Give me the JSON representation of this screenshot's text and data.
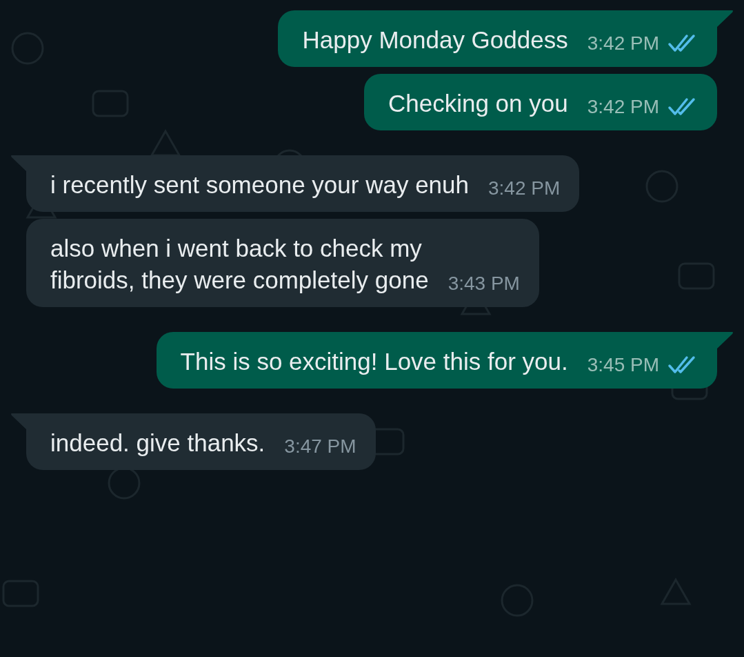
{
  "messages": [
    {
      "kind": "outgoing",
      "text": "Happy Monday Goddess",
      "time": "3:42 PM",
      "read": true,
      "tail": true
    },
    {
      "kind": "outgoing",
      "text": "Checking on you",
      "time": "3:42 PM",
      "read": true,
      "tail": false
    },
    {
      "kind": "incoming",
      "text": "i recently sent someone your way enuh",
      "time": "3:42 PM",
      "tail": true
    },
    {
      "kind": "incoming",
      "text": "also when i went back to check my\nfibroids, they were completely gone",
      "time": "3:43 PM",
      "tail": false
    },
    {
      "kind": "outgoing",
      "text": "This is so exciting! Love this for you.",
      "time": "3:45 PM",
      "read": true,
      "tail": true
    },
    {
      "kind": "incoming",
      "text": "indeed. give thanks.",
      "time": "3:47 PM",
      "tail": true
    }
  ]
}
